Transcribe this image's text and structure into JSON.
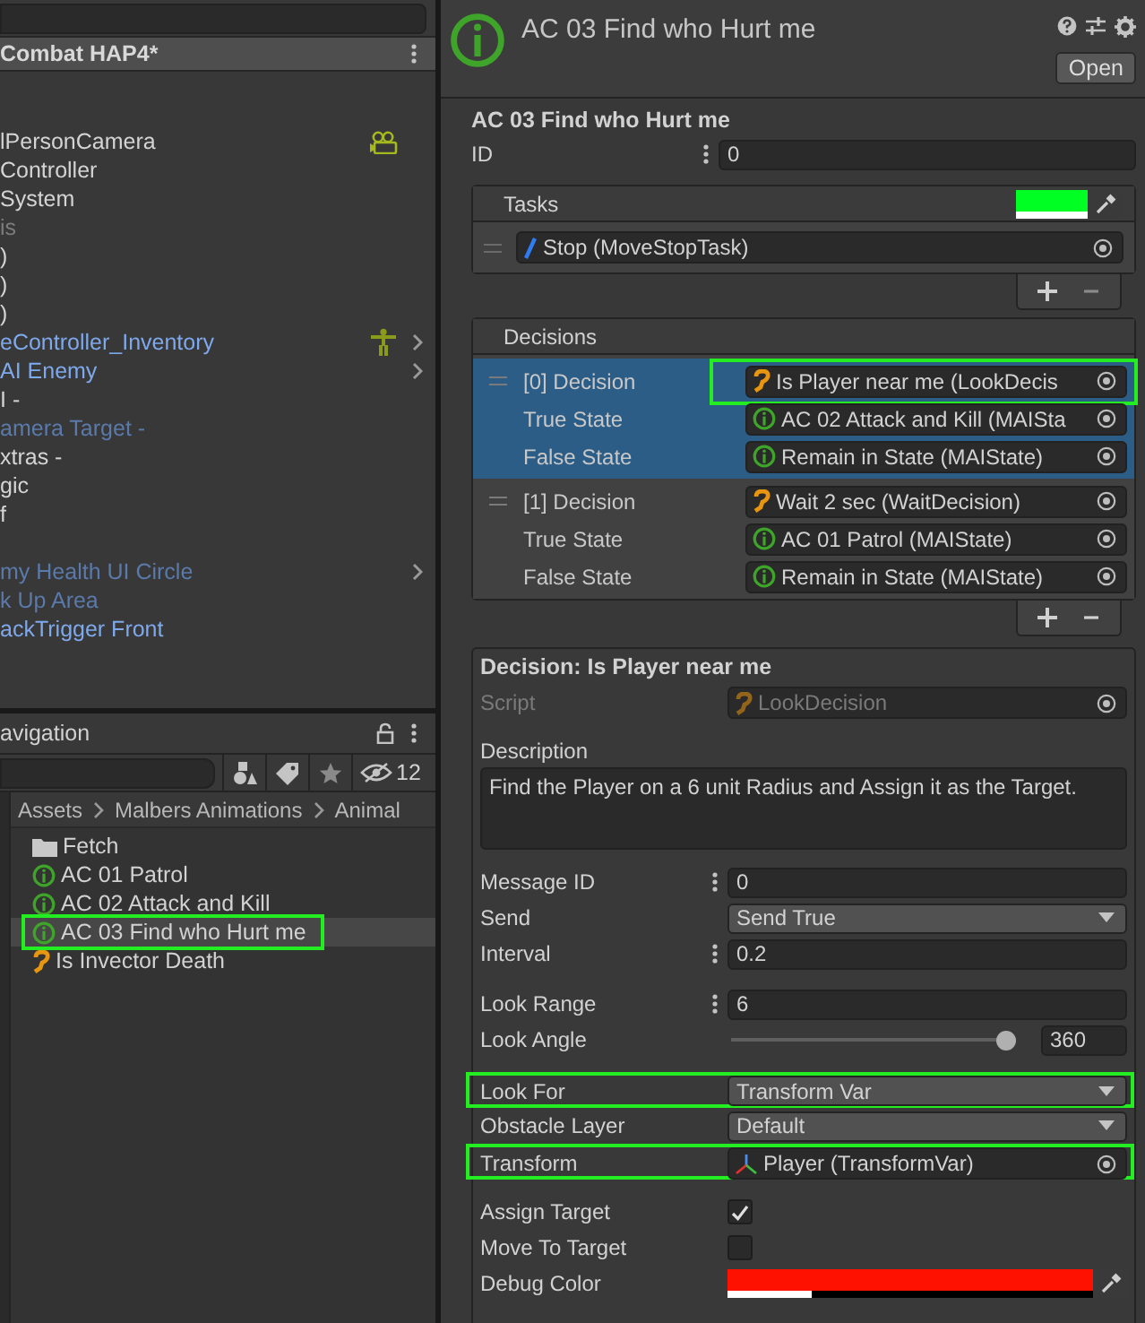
{
  "hierarchy": {
    "scene_title": "Combat HAP4*",
    "items": [
      {
        "label": "lPersonCamera",
        "kind": "object",
        "gizmo": {
          "kind": "camera"
        },
        "expandable": false
      },
      {
        "label": "Controller",
        "kind": "object",
        "expandable": false
      },
      {
        "label": "System",
        "kind": "object",
        "expandable": false
      },
      {
        "label": "is",
        "kind": "inactive",
        "expandable": false
      },
      {
        "label": ")",
        "kind": "object",
        "expandable": false
      },
      {
        "label": ")",
        "kind": "object",
        "expandable": false
      },
      {
        "label": ")",
        "kind": "object",
        "expandable": false
      },
      {
        "label": "eController_Inventory",
        "kind": "prefab",
        "gizmo": {
          "kind": "figure"
        },
        "expandable": true
      },
      {
        "label": "AI Enemy",
        "kind": "prefab",
        "expandable": true
      },
      {
        "label": "I -",
        "kind": "object",
        "expandable": false
      },
      {
        "label": "amera Target -",
        "kind": "prefab_inactive",
        "expandable": false
      },
      {
        "label": "xtras -",
        "kind": "object",
        "expandable": false
      },
      {
        "label": "gic",
        "kind": "object",
        "expandable": false
      },
      {
        "label": "f",
        "kind": "object",
        "expandable": false
      },
      {
        "kind": "object",
        "expandable": false
      },
      {
        "label": "my Health UI Circle",
        "kind": "prefab_inactive",
        "expandable": true
      },
      {
        "label": "k Up Area",
        "kind": "prefab_inactive",
        "expandable": false
      },
      {
        "label": "ackTrigger Front",
        "kind": "prefab",
        "expandable": false
      }
    ]
  },
  "project": {
    "tab": "avigation",
    "hidden_count": "12",
    "breadcrumb": [
      "Assets",
      "Malbers Animations",
      "Animal"
    ],
    "items": [
      {
        "label": "Fetch",
        "kind": "folder",
        "selected": false,
        "highlighted": false
      },
      {
        "label": "AC 01 Patrol",
        "kind": "state",
        "selected": false,
        "highlighted": false
      },
      {
        "label": "AC 02 Attack and Kill",
        "kind": "state",
        "selected": false,
        "highlighted": false
      },
      {
        "label": "AC 03 Find who Hurt me",
        "kind": "state",
        "selected": true,
        "highlighted": true
      },
      {
        "label": "Is Invector Death",
        "kind": "decision",
        "selected": false,
        "highlighted": false
      }
    ]
  },
  "inspector": {
    "header": {
      "title": "AC 03 Find who Hurt me",
      "open_button": "Open"
    },
    "asset_title": "AC 03 Find who Hurt me",
    "id": {
      "label": "ID",
      "value": "0"
    },
    "tasks": {
      "title": "Tasks",
      "color": "#00ff22",
      "level": 1,
      "items": [
        {
          "kind": "task",
          "value": "Stop (MoveStopTask)"
        }
      ]
    },
    "decisions": {
      "title": "Decisions",
      "items": [
        {
          "selected": true,
          "rows": [
            {
              "label": "[0] Decision",
              "kind": "decision",
              "value": "Is Player near me (LookDecis",
              "highlighted": true
            },
            {
              "label": "True State",
              "kind": "state",
              "value": "AC 02 Attack and Kill (MAISta",
              "highlighted": false
            },
            {
              "label": "False State",
              "kind": "state",
              "value": "Remain in State (MAIState)",
              "highlighted": false
            }
          ]
        },
        {
          "selected": false,
          "rows": [
            {
              "label": "[1] Decision",
              "kind": "decision",
              "value": "Wait 2 sec (WaitDecision)",
              "highlighted": false
            },
            {
              "label": "True State",
              "kind": "state",
              "value": "AC 01 Patrol (MAIState)",
              "highlighted": false
            },
            {
              "label": "False State",
              "kind": "state",
              "value": "Remain in State (MAIState)",
              "highlighted": false
            }
          ]
        }
      ]
    },
    "detail": {
      "title": "Decision: Is Player near me",
      "script": {
        "label": "Script",
        "kind": "decision",
        "value": "LookDecision",
        "disabled": true
      },
      "description": {
        "label": "Description",
        "value": "Find the Player on a 6 unit Radius and Assign it as the Target."
      },
      "field_groups": [
        [
          {
            "label": "Message ID",
            "kind": "number",
            "has_menu": true,
            "value": "0",
            "highlighted": false
          },
          {
            "label": "Send",
            "kind": "dropdown",
            "value": "Send True",
            "highlighted": false
          },
          {
            "label": "Interval",
            "kind": "number",
            "has_menu": true,
            "value": "0.2",
            "highlighted": false
          }
        ],
        [
          {
            "label": "Look Range",
            "kind": "number",
            "has_menu": true,
            "value": "6",
            "highlighted": false
          },
          {
            "label": "Look Angle",
            "kind": "slider",
            "level": 1,
            "value": "360",
            "highlighted": false
          }
        ],
        [
          {
            "label": "Look For",
            "kind": "dropdown",
            "value": "Transform Var",
            "highlighted": true
          },
          {
            "label": "Obstacle Layer",
            "kind": "dropdown",
            "value": "Default",
            "highlighted": false
          },
          {
            "label": "Transform",
            "kind": "object",
            "icon": {
              "kind": "transform"
            },
            "value": "Player (TransformVar)",
            "highlighted": true
          }
        ],
        [
          {
            "label": "Assign Target",
            "kind": "checkbox",
            "checked": true,
            "highlighted": false
          },
          {
            "label": "Move To Target",
            "kind": "checkbox",
            "checked": false,
            "highlighted": false
          },
          {
            "label": "Debug Color",
            "kind": "color",
            "color": "#ff1100",
            "level": 0.23,
            "highlighted": false
          }
        ]
      ]
    }
  }
}
